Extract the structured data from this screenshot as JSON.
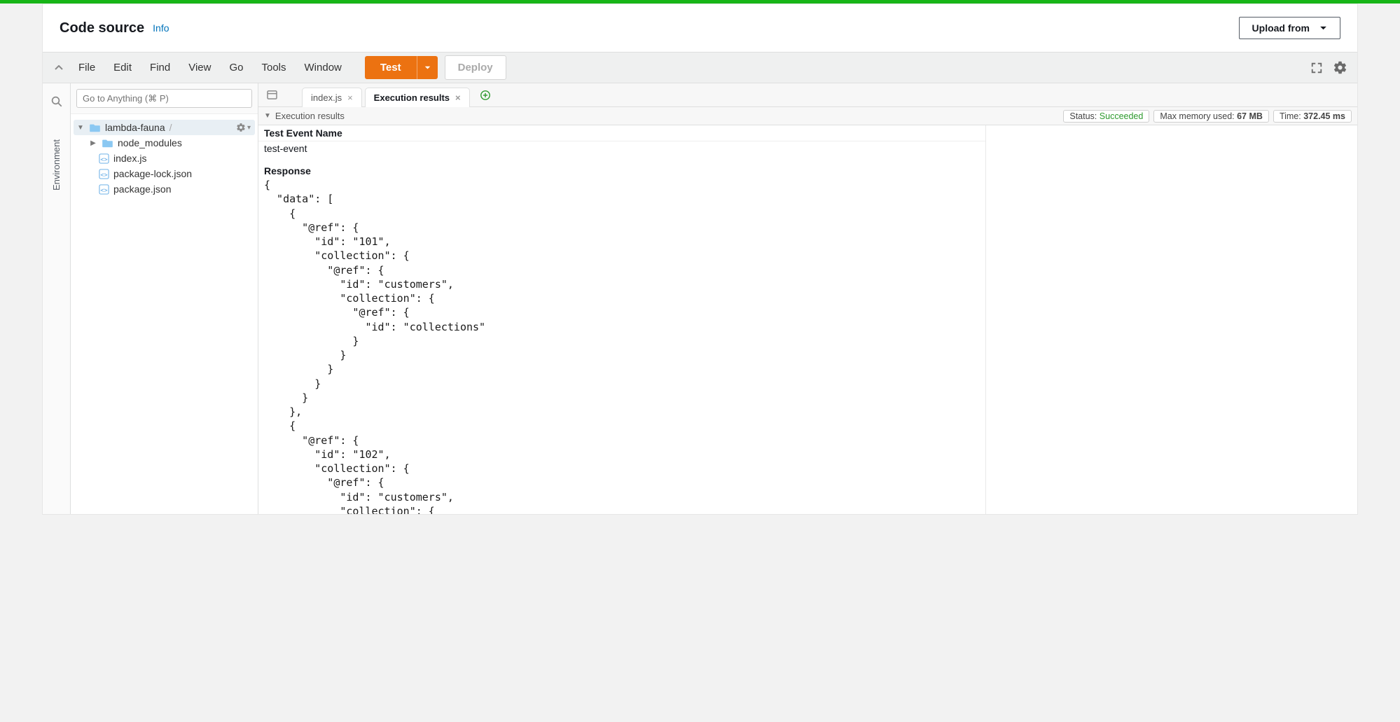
{
  "header": {
    "title": "Code source",
    "info_label": "Info",
    "upload_label": "Upload from"
  },
  "menu": {
    "items": [
      "File",
      "Edit",
      "Find",
      "View",
      "Go",
      "Tools",
      "Window"
    ],
    "test_label": "Test",
    "deploy_label": "Deploy"
  },
  "sidebar": {
    "search_placeholder": "Go to Anything (⌘ P)",
    "env_label": "Environment",
    "tree": {
      "root": "lambda-fauna",
      "root_suffix": "/",
      "children": [
        {
          "type": "folder",
          "label": "node_modules"
        },
        {
          "type": "js",
          "label": "index.js"
        },
        {
          "type": "js",
          "label": "package-lock.json"
        },
        {
          "type": "js",
          "label": "package.json"
        }
      ]
    }
  },
  "tabs": {
    "items": [
      {
        "label": "index.js",
        "active": false
      },
      {
        "label": "Execution results",
        "active": true
      }
    ]
  },
  "status": {
    "section_label": "Execution results",
    "status_label": "Status:",
    "status_value": "Succeeded",
    "memory_label": "Max memory used:",
    "memory_value": "67 MB",
    "time_label": "Time:",
    "time_value": "372.45 ms"
  },
  "results": {
    "test_event_label": "Test Event Name",
    "test_event_value": "test-event",
    "response_label": "Response",
    "response_body": "{\n  \"data\": [\n    {\n      \"@ref\": {\n        \"id\": \"101\",\n        \"collection\": {\n          \"@ref\": {\n            \"id\": \"customers\",\n            \"collection\": {\n              \"@ref\": {\n                \"id\": \"collections\"\n              }\n            }\n          }\n        }\n      }\n    },\n    {\n      \"@ref\": {\n        \"id\": \"102\",\n        \"collection\": {\n          \"@ref\": {\n            \"id\": \"customers\",\n            \"collection\": {\n              \"@ref\": {\n                \"id\": \"collections\"\n              }"
  }
}
